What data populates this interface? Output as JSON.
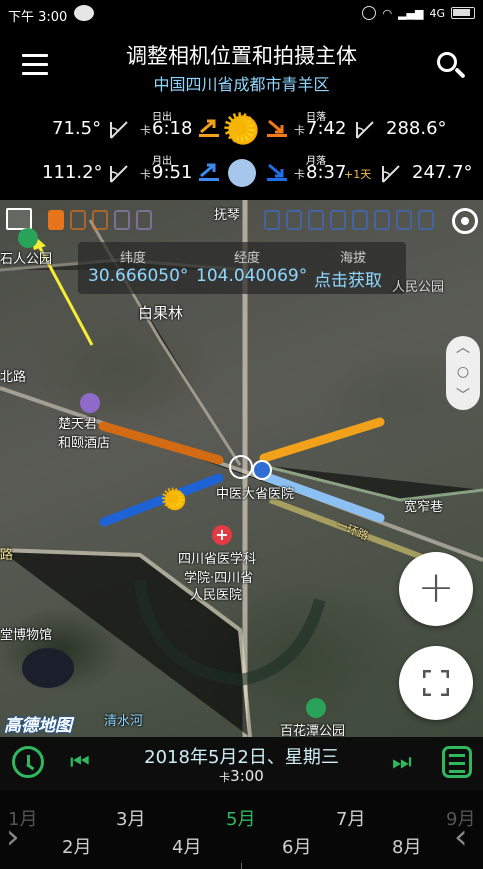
{
  "status_bar": {
    "time": "下午 3:00",
    "network": "4G"
  },
  "header": {
    "title": "调整相机位置和拍摄主体",
    "subtitle": "中国四川省成都市青羊区"
  },
  "sun_row": {
    "left_angle": "71.5°",
    "rise_label": "日出",
    "rise_prefix": "卡",
    "rise_time": "6:18",
    "set_label": "日落",
    "set_prefix": "卡",
    "set_time": "7:42",
    "right_angle": "288.6°"
  },
  "moon_row": {
    "left_angle": "111.2°",
    "rise_label": "月出",
    "rise_prefix": "卡",
    "rise_time": "9:51",
    "set_label": "月落",
    "set_prefix": "卡",
    "set_time": "8:37",
    "set_extra": "+1天",
    "right_angle": "247.7°"
  },
  "map": {
    "coord_headers": {
      "lat": "纬度",
      "lng": "经度",
      "alt": "海拔"
    },
    "lat_value": "30.666050°",
    "lng_value": "104.040069°",
    "alt_value": "点击获取",
    "labels": {
      "shirenpark": "石人公园",
      "baiguolin": "白果林",
      "baihuatan_n": "人民公园",
      "lu_left": "北路",
      "hotel": "楚天君",
      "hotel2": "和颐酒店",
      "hospital": "中医大省医院",
      "academy1": "四川省医学科",
      "academy2": "学院·四川省",
      "academy3": "人民医院",
      "museum": "堂博物馆",
      "road_left": "路",
      "kuanzhai": "宽窄巷",
      "baihuatan": "百花潭公园",
      "qingshui": "清水河",
      "road_diag": "一环路",
      "fu": "抚琴",
      "logo": "高德地图"
    },
    "zoom_up": "︿",
    "zoom_mid": "○",
    "zoom_down": "﹀",
    "plus_label": "+"
  },
  "bottom": {
    "date": "2018年5月2日、星期三",
    "time_prefix": "卡",
    "time": "3:00",
    "months_top": [
      "1月",
      "3月",
      "5月",
      "7月",
      "9月"
    ],
    "months_bottom": [
      "2月",
      "4月",
      "6月",
      "8月"
    ],
    "selected_month": "5月"
  },
  "colors": {
    "accent_green": "#2fb85e",
    "sky_blue": "#8fd7ff",
    "sun_orange": "#e07818",
    "moon_blue": "#1d63d6"
  }
}
